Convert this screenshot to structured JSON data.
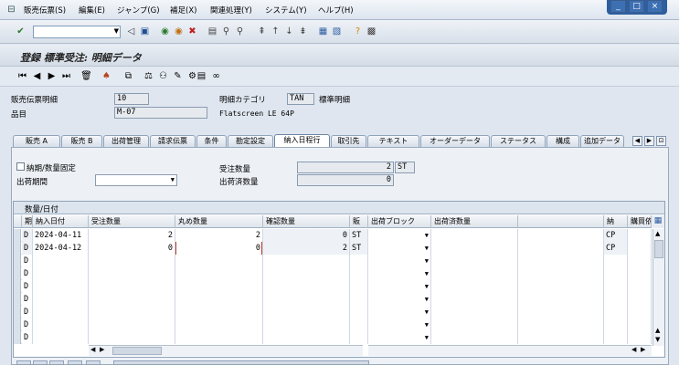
{
  "menu": {
    "items": [
      "販売伝票(S)",
      "編集(E)",
      "ジャンプ(G)",
      "補足(X)",
      "関連処理(Y)",
      "システム(Y)",
      "ヘルプ(H)"
    ]
  },
  "window": {
    "controls": [
      "_",
      "□",
      "×"
    ]
  },
  "toolbar": {
    "command_value": "",
    "icons": [
      "check-icon",
      "save-icon",
      "back-icon",
      "exit-icon",
      "cancel-icon",
      "print-icon",
      "find-icon",
      "find-next-icon",
      "first-page-icon",
      "prev-page-icon",
      "next-page-icon",
      "last-page-icon",
      "new-session-icon",
      "shortcut-icon",
      "help-icon",
      "layout-icon"
    ]
  },
  "title": "登録 標準受注: 明細データ",
  "app_toolbar": {
    "icons": [
      "first-item-icon",
      "prev-item-icon",
      "next-item-icon",
      "last-item-icon",
      "delete-icon",
      "copy-icon",
      "display-icon",
      "pricing-icon",
      "schedule-icon",
      "create-icon",
      "document-flow-icon",
      "glasses-icon"
    ]
  },
  "header": {
    "item_label": "販売伝票明細",
    "item_value": "10",
    "material_label": "品目",
    "material_value": "M-07",
    "category_label": "明細カテゴリ",
    "category_value": "TAN",
    "category_text": "標準明細",
    "material_text": "Flatscreen LE 64P"
  },
  "tabs": [
    "販売 A",
    "販売 B",
    "出荷管理",
    "請求伝票",
    "条件",
    "勘定設定",
    "納入日程行",
    "取引先",
    "テキスト",
    "オーダーデータ",
    "ステータス",
    "構成",
    "追加データ"
  ],
  "active_tab": "納入日程行",
  "schedule": {
    "fixed_checkbox_label": "納期/数量固定",
    "delivery_block_label": "出荷期間",
    "order_qty_label": "受注数量",
    "order_qty_value": "2",
    "order_qty_unit": "ST",
    "delivered_qty_label": "出荷済数量",
    "delivered_qty_value": "0"
  },
  "table": {
    "title": "数量/日付",
    "columns": [
      "期",
      "納入日付",
      "受注数量",
      "丸め数量",
      "確認数量",
      "販",
      "出荷ブロック",
      "出荷済数量",
      "",
      "納",
      "購買依"
    ],
    "rows": [
      {
        "type": "D",
        "date": "2024-04-11",
        "order_qty": "2",
        "round_qty": "2",
        "conf_qty": "0",
        "unit": "ST",
        "cat": "CP"
      },
      {
        "type": "D",
        "date": "2024-04-12",
        "order_qty": "0",
        "round_qty": "0",
        "conf_qty": "2",
        "unit": "ST",
        "cat": "CP"
      },
      {
        "type": "D",
        "date": "",
        "order_qty": "",
        "round_qty": "",
        "conf_qty": "",
        "unit": "",
        "cat": ""
      },
      {
        "type": "D",
        "date": "",
        "order_qty": "",
        "round_qty": "",
        "conf_qty": "",
        "unit": "",
        "cat": ""
      },
      {
        "type": "D",
        "date": "",
        "order_qty": "",
        "round_qty": "",
        "conf_qty": "",
        "unit": "",
        "cat": ""
      },
      {
        "type": "D",
        "date": "",
        "order_qty": "",
        "round_qty": "",
        "conf_qty": "",
        "unit": "",
        "cat": ""
      },
      {
        "type": "D",
        "date": "",
        "order_qty": "",
        "round_qty": "",
        "conf_qty": "",
        "unit": "",
        "cat": ""
      },
      {
        "type": "D",
        "date": "",
        "order_qty": "",
        "round_qty": "",
        "conf_qty": "",
        "unit": "",
        "cat": ""
      },
      {
        "type": "D",
        "date": "",
        "order_qty": "",
        "round_qty": "",
        "conf_qty": "",
        "unit": "",
        "cat": ""
      }
    ]
  },
  "colors": {
    "accent": "#2d5ea0",
    "panel": "#edf1f6",
    "active_tab": "#ffffff",
    "red_mark": "#c0392b"
  }
}
